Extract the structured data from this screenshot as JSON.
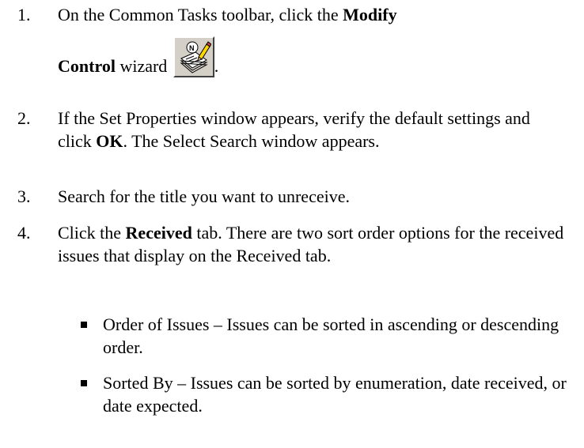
{
  "steps": [
    {
      "num": "1.",
      "line1": "On the Common Tasks toolbar, click the ",
      "bold1": "Modify",
      "bold2": "Control",
      "text2": " wizard ",
      "end": "."
    },
    {
      "num": "2.",
      "pre": "If the Set Properties window appears, verify the default settings and click ",
      "bold": "OK",
      "post": ". The Select Search window appears."
    },
    {
      "num": "3.",
      "text": "Search for the title you want to unreceive."
    },
    {
      "num": "4.",
      "pre": "Click the ",
      "bold": "Received",
      "post": " tab. There are two sort order options for the received issues that display on the Received tab."
    }
  ],
  "bullets": [
    "Order of Issues – Issues can be sorted in ascending or descending order.",
    "Sorted By – Issues can be sorted by enumeration, date received, or date expected."
  ],
  "icons": {
    "wizard": "modify-control-wizard-icon"
  }
}
